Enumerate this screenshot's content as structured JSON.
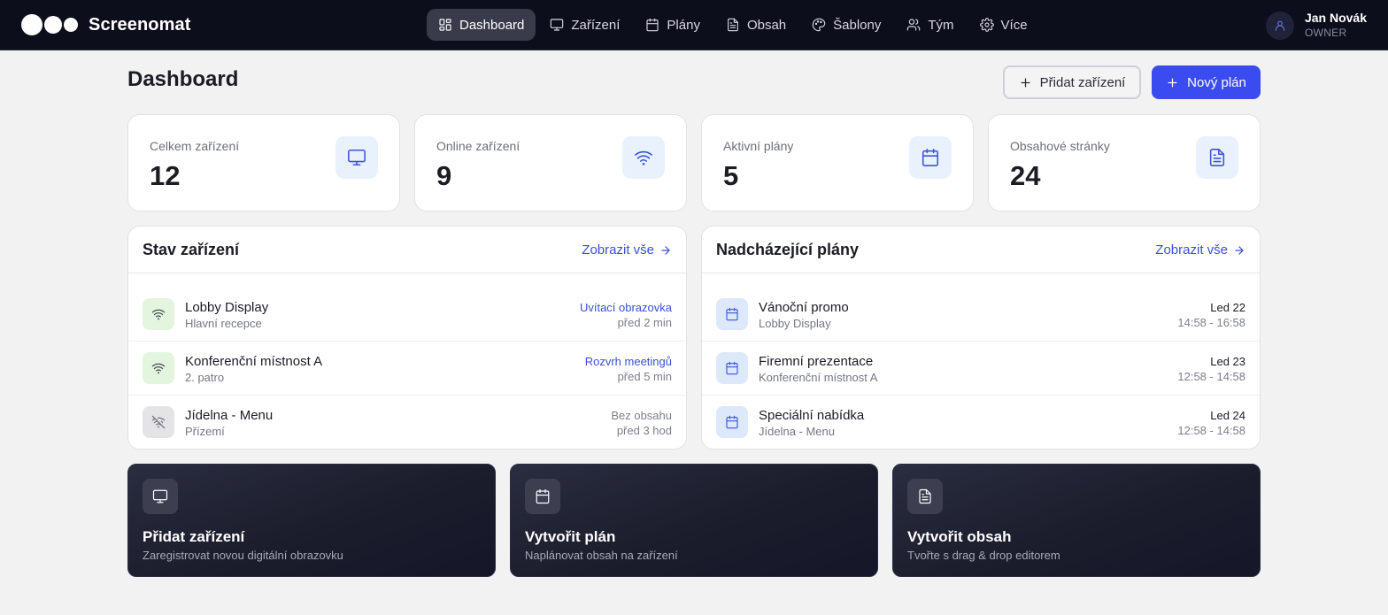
{
  "app": {
    "name": "Screenomat"
  },
  "nav": [
    {
      "label": "Dashboard",
      "icon": "grid-icon",
      "active": true
    },
    {
      "label": "Zařízení",
      "icon": "monitor-icon"
    },
    {
      "label": "Plány",
      "icon": "calendar-icon"
    },
    {
      "label": "Obsah",
      "icon": "document-icon"
    },
    {
      "label": "Šablony",
      "icon": "palette-icon"
    },
    {
      "label": "Tým",
      "icon": "users-icon"
    },
    {
      "label": "Více",
      "icon": "gear-icon"
    }
  ],
  "user": {
    "name": "Jan Novák",
    "role": "OWNER"
  },
  "page": {
    "title": "Dashboard",
    "add_device_label": "Přidat zařízení",
    "new_plan_label": "Nový plán"
  },
  "stats": [
    {
      "label": "Celkem zařízení",
      "value": "12",
      "icon": "monitor-icon"
    },
    {
      "label": "Online zařízení",
      "value": "9",
      "icon": "wifi-icon"
    },
    {
      "label": "Aktivní plány",
      "value": "5",
      "icon": "calendar-icon"
    },
    {
      "label": "Obsahové stránky",
      "value": "24",
      "icon": "document-icon"
    }
  ],
  "devices_panel": {
    "title": "Stav zařízení",
    "link_label": "Zobrazit vše",
    "rows": [
      {
        "name": "Lobby Display",
        "location": "Hlavní recepce",
        "content": "Uvítací obrazovka",
        "time": "před 2 min",
        "status": "online"
      },
      {
        "name": "Konferenční místnost A",
        "location": "2. patro",
        "content": "Rozvrh meetingů",
        "time": "před 5 min",
        "status": "online"
      },
      {
        "name": "Jídelna - Menu",
        "location": "Přízemí",
        "content": "Bez obsahu",
        "time": "před 3 hod",
        "status": "offline"
      }
    ]
  },
  "plans_panel": {
    "title": "Nadcházející plány",
    "link_label": "Zobrazit vše",
    "rows": [
      {
        "name": "Vánoční promo",
        "device": "Lobby Display",
        "date": "Led 22",
        "time": "14:58 - 16:58"
      },
      {
        "name": "Firemní prezentace",
        "device": "Konferenční místnost A",
        "date": "Led 23",
        "time": "12:58 - 14:58"
      },
      {
        "name": "Speciální nabídka",
        "device": "Jídelna - Menu",
        "date": "Led 24",
        "time": "12:58 - 14:58"
      }
    ]
  },
  "actions": [
    {
      "title": "Přidat zařízení",
      "subtitle": "Zaregistrovat novou digitální obrazovku",
      "icon": "monitor-icon"
    },
    {
      "title": "Vytvořit plán",
      "subtitle": "Naplánovat obsah na zařízení",
      "icon": "calendar-icon"
    },
    {
      "title": "Vytvořit obsah",
      "subtitle": "Tvořte s drag & drop editorem",
      "icon": "document-icon"
    }
  ],
  "colors": {
    "topbar": "#0d0e1c",
    "accent": "#3a4cf0",
    "link": "#3b4fd6",
    "background": "#f2f2f3"
  }
}
